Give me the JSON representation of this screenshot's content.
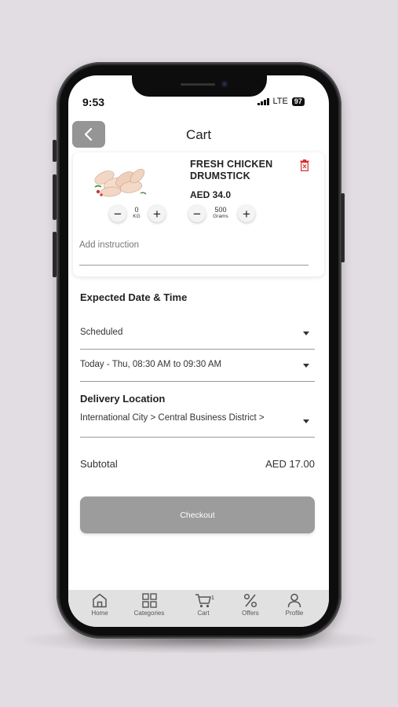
{
  "status_bar": {
    "time": "9:53",
    "network": "LTE",
    "battery": "97"
  },
  "header": {
    "title": "Cart"
  },
  "cart_item": {
    "name": "FRESH CHICKEN DRUMSTICK",
    "price": "AED 34.0",
    "kg_stepper": {
      "value": "0",
      "unit": "KG"
    },
    "grams_stepper": {
      "value": "500",
      "unit": "Grams"
    },
    "instruction_placeholder": "Add instruction"
  },
  "delivery_time": {
    "section_title": "Expected Date & Time",
    "mode": "Scheduled",
    "slot": "Today - Thu, 08:30 AM to 09:30 AM"
  },
  "delivery_location": {
    "section_title": "Delivery Location",
    "value": "International City > Central Business District >"
  },
  "summary": {
    "subtotal_label": "Subtotal",
    "subtotal_value": "AED 17.00"
  },
  "checkout_label": "Checkout",
  "tabbar": {
    "items": [
      {
        "label": "Home",
        "icon": "home-icon"
      },
      {
        "label": "Categories",
        "icon": "grid-icon"
      },
      {
        "label": "Cart",
        "icon": "cart-icon",
        "badge": "1"
      },
      {
        "label": "Offers",
        "icon": "percent-icon"
      },
      {
        "label": "Profile",
        "icon": "person-icon"
      }
    ]
  },
  "colors": {
    "background": "#e2dde2",
    "button_grey": "#9c9c9c",
    "delete_red": "#d9302c",
    "tabbar_bg": "#e1e1e1"
  }
}
